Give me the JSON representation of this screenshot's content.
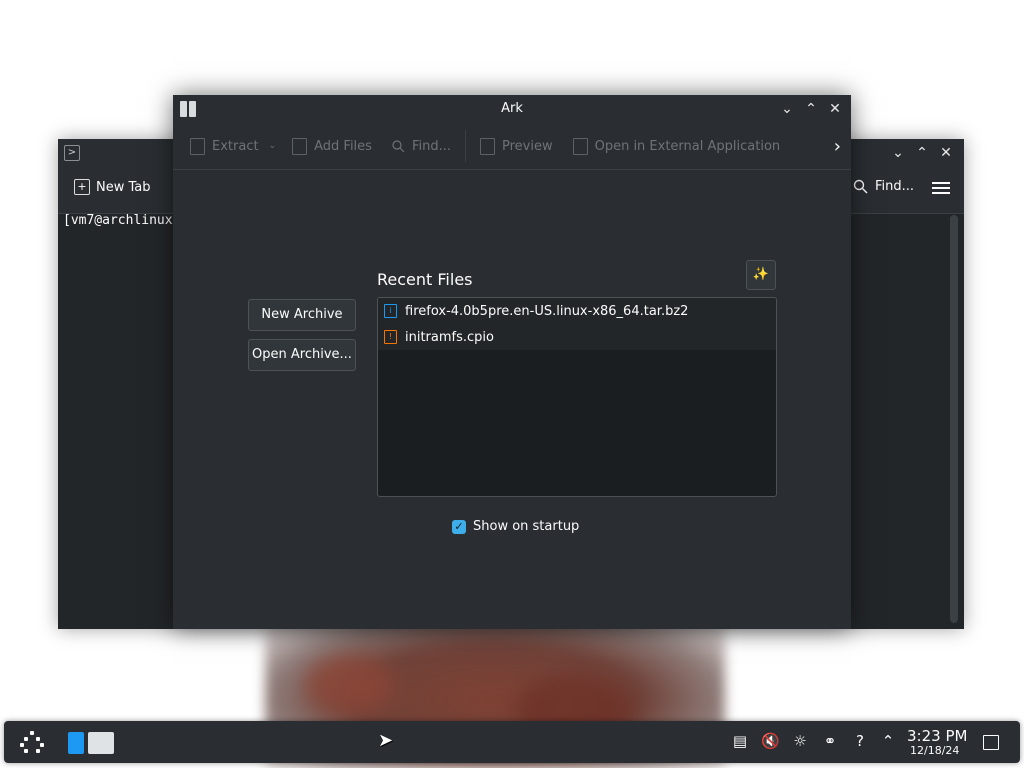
{
  "konsole": {
    "new_tab_label": "New Tab",
    "find_label": "Find...",
    "terminal_line": "[vm7@archlinux"
  },
  "ark": {
    "title": "Ark",
    "toolbar": {
      "extract": "Extract",
      "add_files": "Add Files",
      "find": "Find...",
      "preview": "Preview",
      "open_external": "Open in External Application"
    },
    "recent_title": "Recent Files",
    "new_archive": "New Archive",
    "open_archive": "Open Archive...",
    "recent_files": [
      {
        "name": "firefox-4.0b5pre.en-US.linux-x86_64.tar.bz2",
        "icon": "archive-icon-blue"
      },
      {
        "name": "initramfs.cpio",
        "icon": "archive-icon-orange"
      }
    ],
    "show_on_startup": "Show on startup",
    "show_on_startup_checked": true
  },
  "taskbar": {
    "time": "3:23 PM",
    "date": "12/18/24",
    "tray_icons": [
      "clipboard-icon",
      "volume-muted-icon",
      "brightness-icon",
      "network-icon",
      "help-icon",
      "expand-tray-icon"
    ]
  },
  "colors": {
    "accent": "#3daee9",
    "window_bg": "#2a2e32",
    "view_bg": "#1b1e20",
    "close_red": "#da4453"
  }
}
